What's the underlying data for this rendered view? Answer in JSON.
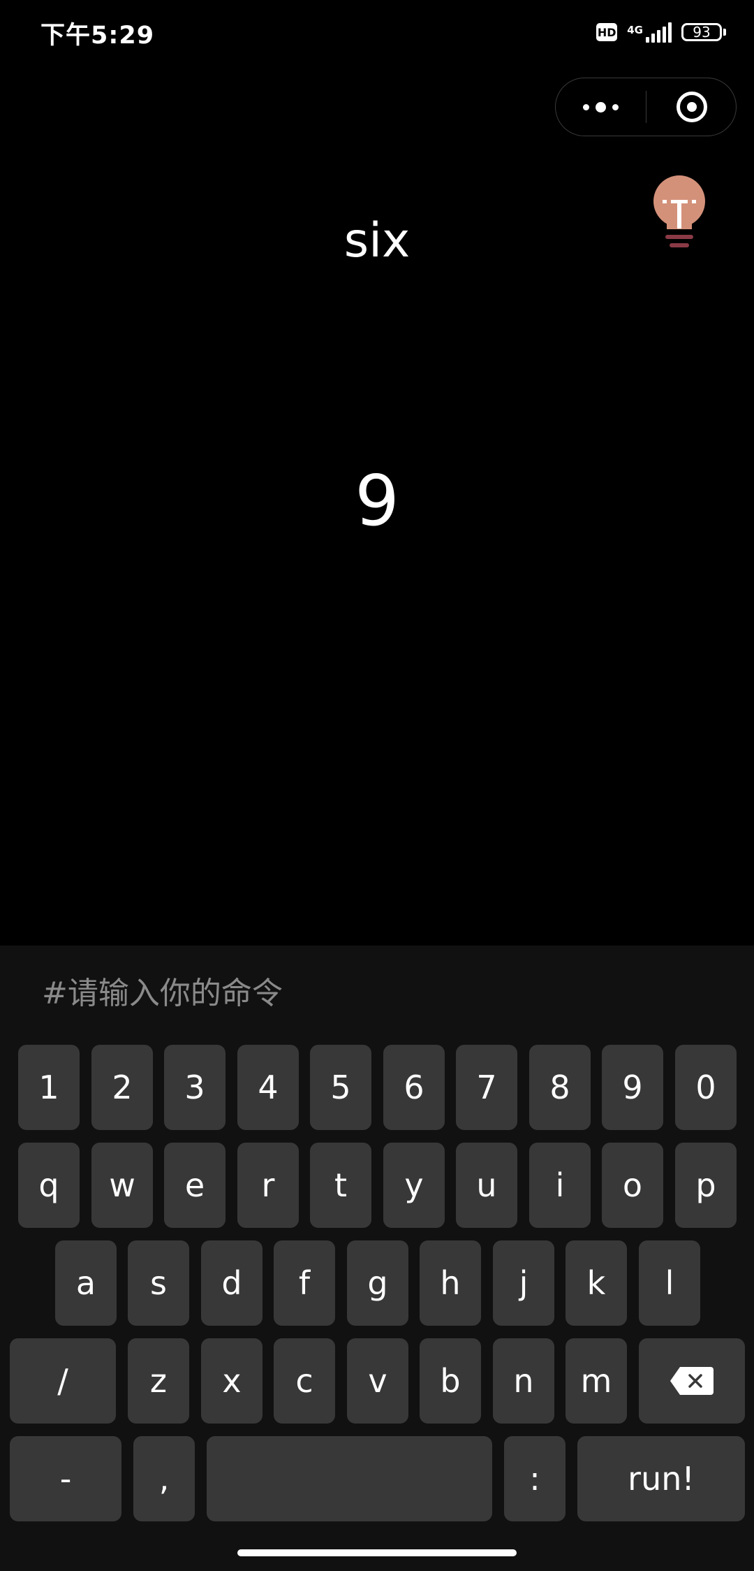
{
  "status_bar": {
    "time": "下午5:29",
    "hd_badge": "HD",
    "network": "4G",
    "battery": "93",
    "icons": [
      "hd-icon",
      "signal-icon",
      "battery-icon"
    ]
  },
  "capsule": {
    "more_icon": "more-dots-icon",
    "close_icon": "target-circle-icon"
  },
  "hint_icon": "lightbulb-icon",
  "main": {
    "word": "six",
    "number": "9"
  },
  "command": {
    "placeholder": "#请输入你的命令",
    "value": ""
  },
  "keyboard": {
    "row1": [
      "1",
      "2",
      "3",
      "4",
      "5",
      "6",
      "7",
      "8",
      "9",
      "0"
    ],
    "row2": [
      "q",
      "w",
      "e",
      "r",
      "t",
      "y",
      "u",
      "i",
      "o",
      "p"
    ],
    "row3": [
      "a",
      "s",
      "d",
      "f",
      "g",
      "h",
      "j",
      "k",
      "l"
    ],
    "row4": [
      "/",
      "z",
      "x",
      "c",
      "v",
      "b",
      "n",
      "m"
    ],
    "row5": [
      "-",
      ",",
      "",
      ":",
      "run!"
    ],
    "delete_icon": "backspace-icon"
  },
  "colors": {
    "background": "#000000",
    "keyboard_background": "#111111",
    "key": "#383838",
    "bulb": "#d4917a",
    "bulb_base": "#8a3a46"
  }
}
